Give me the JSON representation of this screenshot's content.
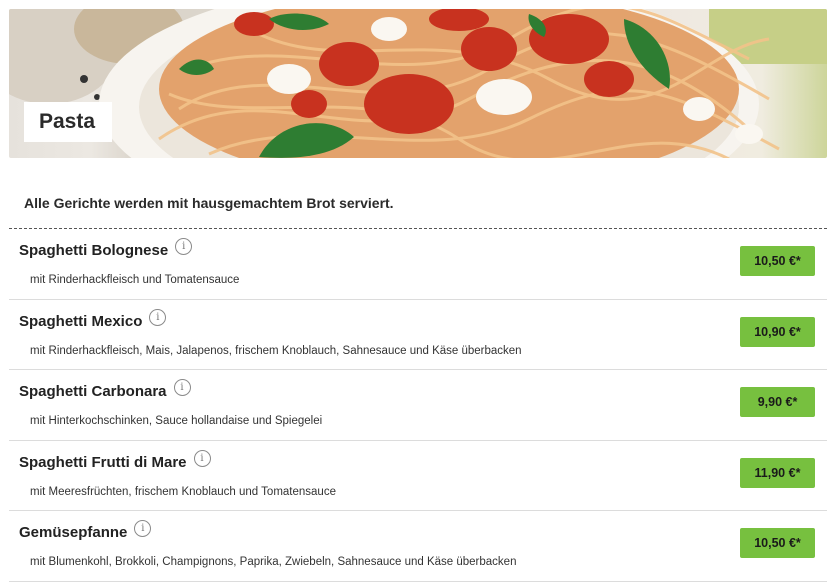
{
  "category": {
    "title": "Pasta",
    "image_icon": "pasta-dish-photo"
  },
  "note": "Alle Gerichte werden mit hausgemachtem Brot serviert.",
  "info_icon_glyph": "i",
  "colors": {
    "price_button": "#77c03f",
    "divider": "#dcdcdc"
  },
  "items": [
    {
      "name": "Spaghetti Bolognese",
      "description": "mit Rinderhackfleisch und Tomatensauce",
      "price": "10,50 €*"
    },
    {
      "name": "Spaghetti Mexico",
      "description": "mit Rinderhackfleisch, Mais, Jalapenos, frischem Knoblauch, Sahnesauce und Käse überbacken",
      "price": "10,90 €*"
    },
    {
      "name": "Spaghetti Carbonara",
      "description": "mit Hinterkochschinken, Sauce hollandaise und Spiegelei",
      "price": "9,90 €*"
    },
    {
      "name": "Spaghetti Frutti di Mare",
      "description": "mit Meeresfrüchten, frischem Knoblauch und Tomatensauce",
      "price": "11,90 €*"
    },
    {
      "name": "Gemüsepfanne",
      "description": "mit Blumenkohl, Brokkoli, Champignons, Paprika, Zwiebeln, Sahnesauce und Käse überbacken",
      "price": "10,50 €*"
    }
  ]
}
